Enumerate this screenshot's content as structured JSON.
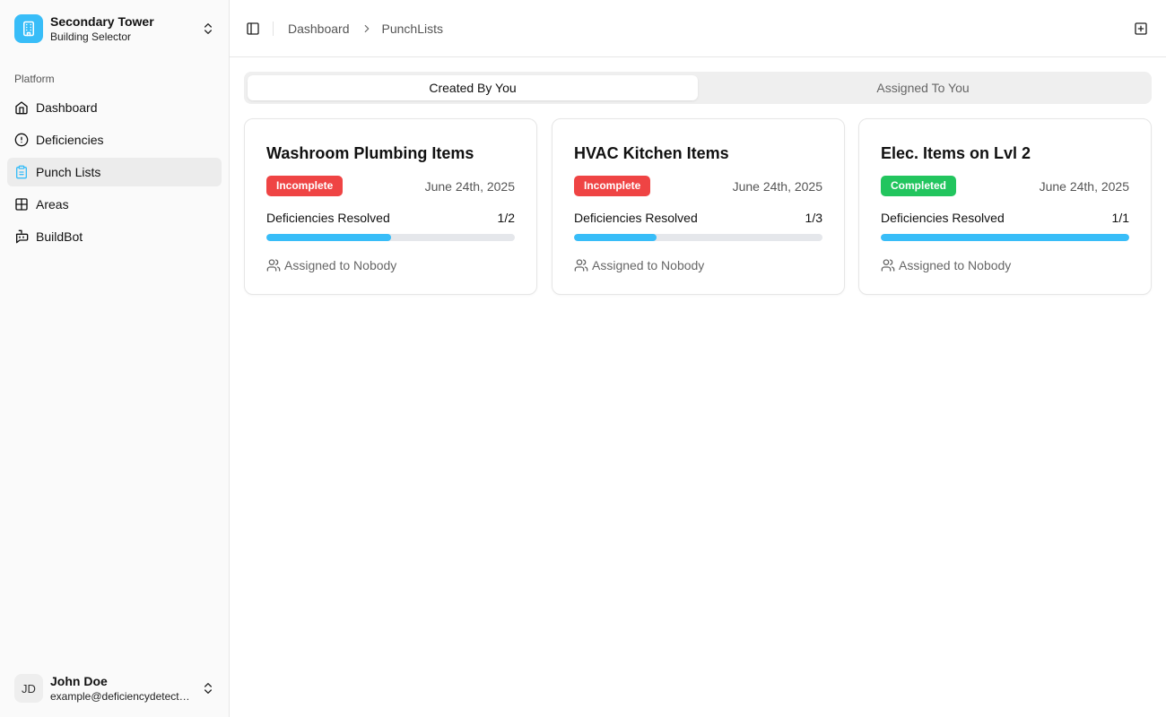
{
  "building": {
    "name": "Secondary Tower",
    "subtitle": "Building Selector"
  },
  "sidebar": {
    "group_label": "Platform",
    "items": [
      {
        "label": "Dashboard",
        "icon": "home-icon"
      },
      {
        "label": "Deficiencies",
        "icon": "alert-circle-icon"
      },
      {
        "label": "Punch Lists",
        "icon": "clipboard-icon",
        "active": true
      },
      {
        "label": "Areas",
        "icon": "layout-grid-icon"
      },
      {
        "label": "BuildBot",
        "icon": "bot-icon"
      }
    ]
  },
  "user": {
    "initials": "JD",
    "name": "John Doe",
    "email": "example@deficiencydetect.com"
  },
  "breadcrumb": {
    "parent": "Dashboard",
    "current": "PunchLists"
  },
  "tabs": [
    {
      "label": "Created By You",
      "active": true
    },
    {
      "label": "Assigned To You",
      "active": false
    }
  ],
  "cards": [
    {
      "title": "Washroom Plumbing Items",
      "status": "Incomplete",
      "status_color": "#ef4444",
      "date": "June 24th, 2025",
      "resolved_label": "Deficiencies Resolved",
      "resolved_count": "1/2",
      "progress": 0.5,
      "assignee": "Assigned to Nobody"
    },
    {
      "title": "HVAC Kitchen Items",
      "status": "Incomplete",
      "status_color": "#ef4444",
      "date": "June 24th, 2025",
      "resolved_label": "Deficiencies Resolved",
      "resolved_count": "1/3",
      "progress": 0.333,
      "assignee": "Assigned to Nobody"
    },
    {
      "title": "Elec. Items on Lvl 2",
      "status": "Completed",
      "status_color": "#22c55e",
      "date": "June 24th, 2025",
      "resolved_label": "Deficiencies Resolved",
      "resolved_count": "1/1",
      "progress": 1.0,
      "assignee": "Assigned to Nobody"
    }
  ],
  "colors": {
    "accent": "#38bdf8",
    "incomplete": "#ef4444",
    "completed": "#22c55e"
  }
}
